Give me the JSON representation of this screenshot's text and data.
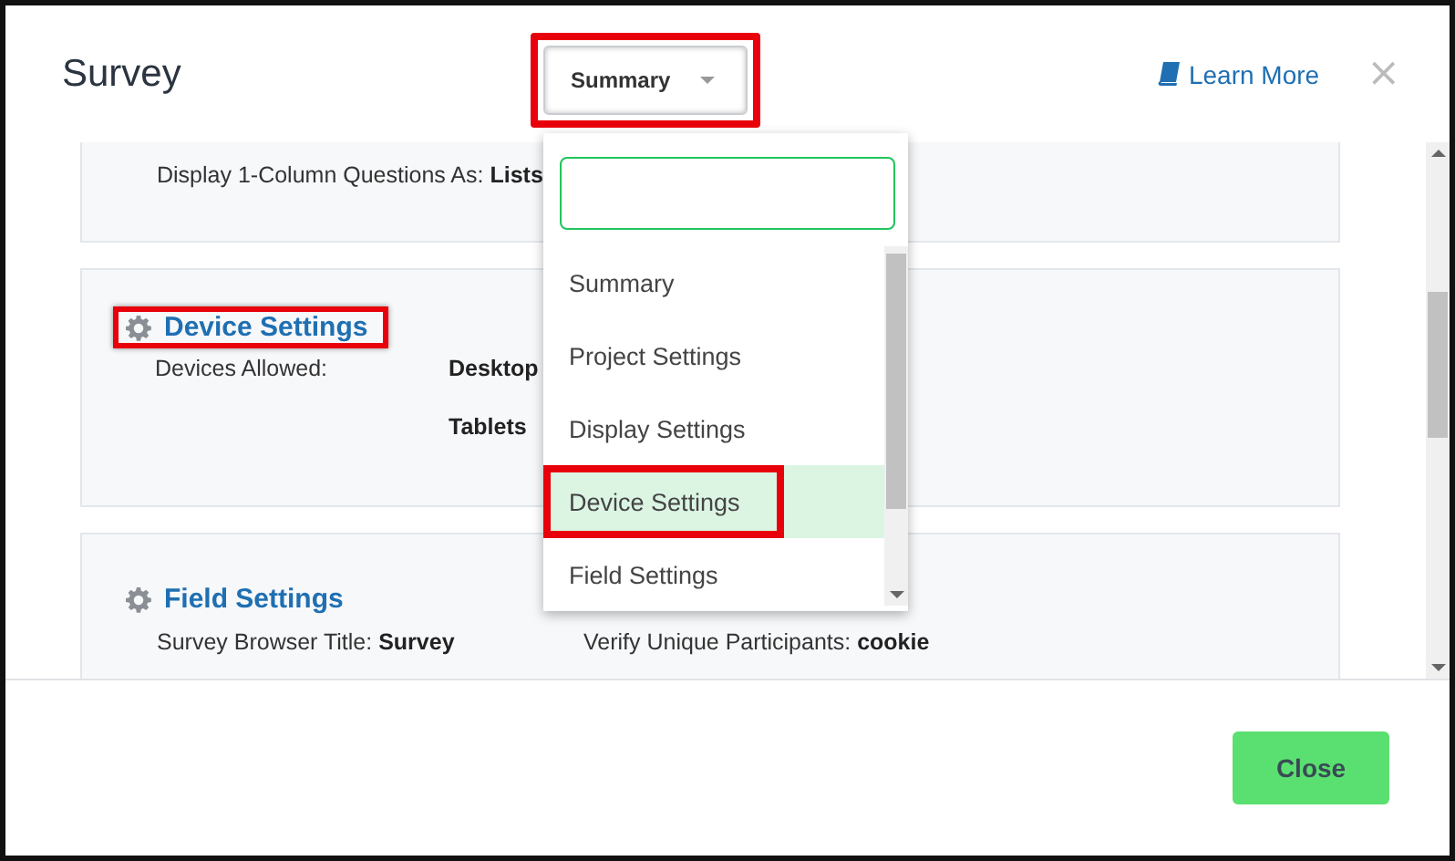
{
  "modal": {
    "title": "Survey",
    "learn_more": "Learn More",
    "close_icon": "×"
  },
  "section_select": {
    "value": "Summary",
    "annotated": true,
    "open": true
  },
  "dropdown": {
    "options": [
      {
        "label": "Summary",
        "selected": false,
        "annotated": false
      },
      {
        "label": "Project Settings",
        "selected": false,
        "annotated": false
      },
      {
        "label": "Display Settings",
        "selected": false,
        "annotated": false
      },
      {
        "label": "Device Settings",
        "selected": true,
        "annotated": true
      },
      {
        "label": "Field Settings",
        "selected": false,
        "annotated": false
      }
    ]
  },
  "sections": [
    {
      "kind": "inline",
      "annotated": false,
      "rows": [
        {
          "label": "Display 1-Column Questions As:",
          "value": "Lists"
        }
      ]
    },
    {
      "kind": "columns",
      "title": "Device Settings",
      "annotated": true,
      "rows": [
        {
          "label": "Devices Allowed:",
          "value": "Desktop"
        },
        {
          "value": "Tablets"
        }
      ]
    },
    {
      "kind": "inline",
      "title": "Field Settings",
      "annotated": false,
      "rows": [
        {
          "label": "Survey Browser Title:",
          "value": "Survey"
        },
        {
          "label": "Verify Unique Participants:",
          "value": "cookie"
        }
      ]
    }
  ],
  "footer": {
    "button": "Close"
  }
}
